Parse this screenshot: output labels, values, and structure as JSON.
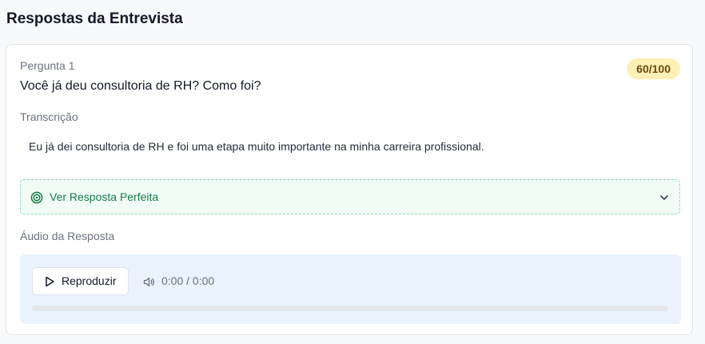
{
  "page": {
    "title": "Respostas da Entrevista"
  },
  "question": {
    "label": "Pergunta 1",
    "text": "Você já deu consultoria de RH? Como foi?",
    "score": "60/100"
  },
  "transcription": {
    "label": "Transcrição",
    "text": "Eu já dei consultoria de RH e foi uma etapa muito importante na minha carreira profissional."
  },
  "perfect_answer": {
    "label": "Ver Resposta Perfeita",
    "icon": "target-icon",
    "expanded": false
  },
  "audio": {
    "label": "Áudio da Resposta",
    "play_label": "Reproduzir",
    "time": "0:00 / 0:00",
    "progress": 0
  },
  "colors": {
    "score_bg": "#fdf0b5",
    "score_text": "#6b4a12",
    "perfect_accent": "#137a46",
    "audio_panel_bg": "#eaf2fd"
  }
}
